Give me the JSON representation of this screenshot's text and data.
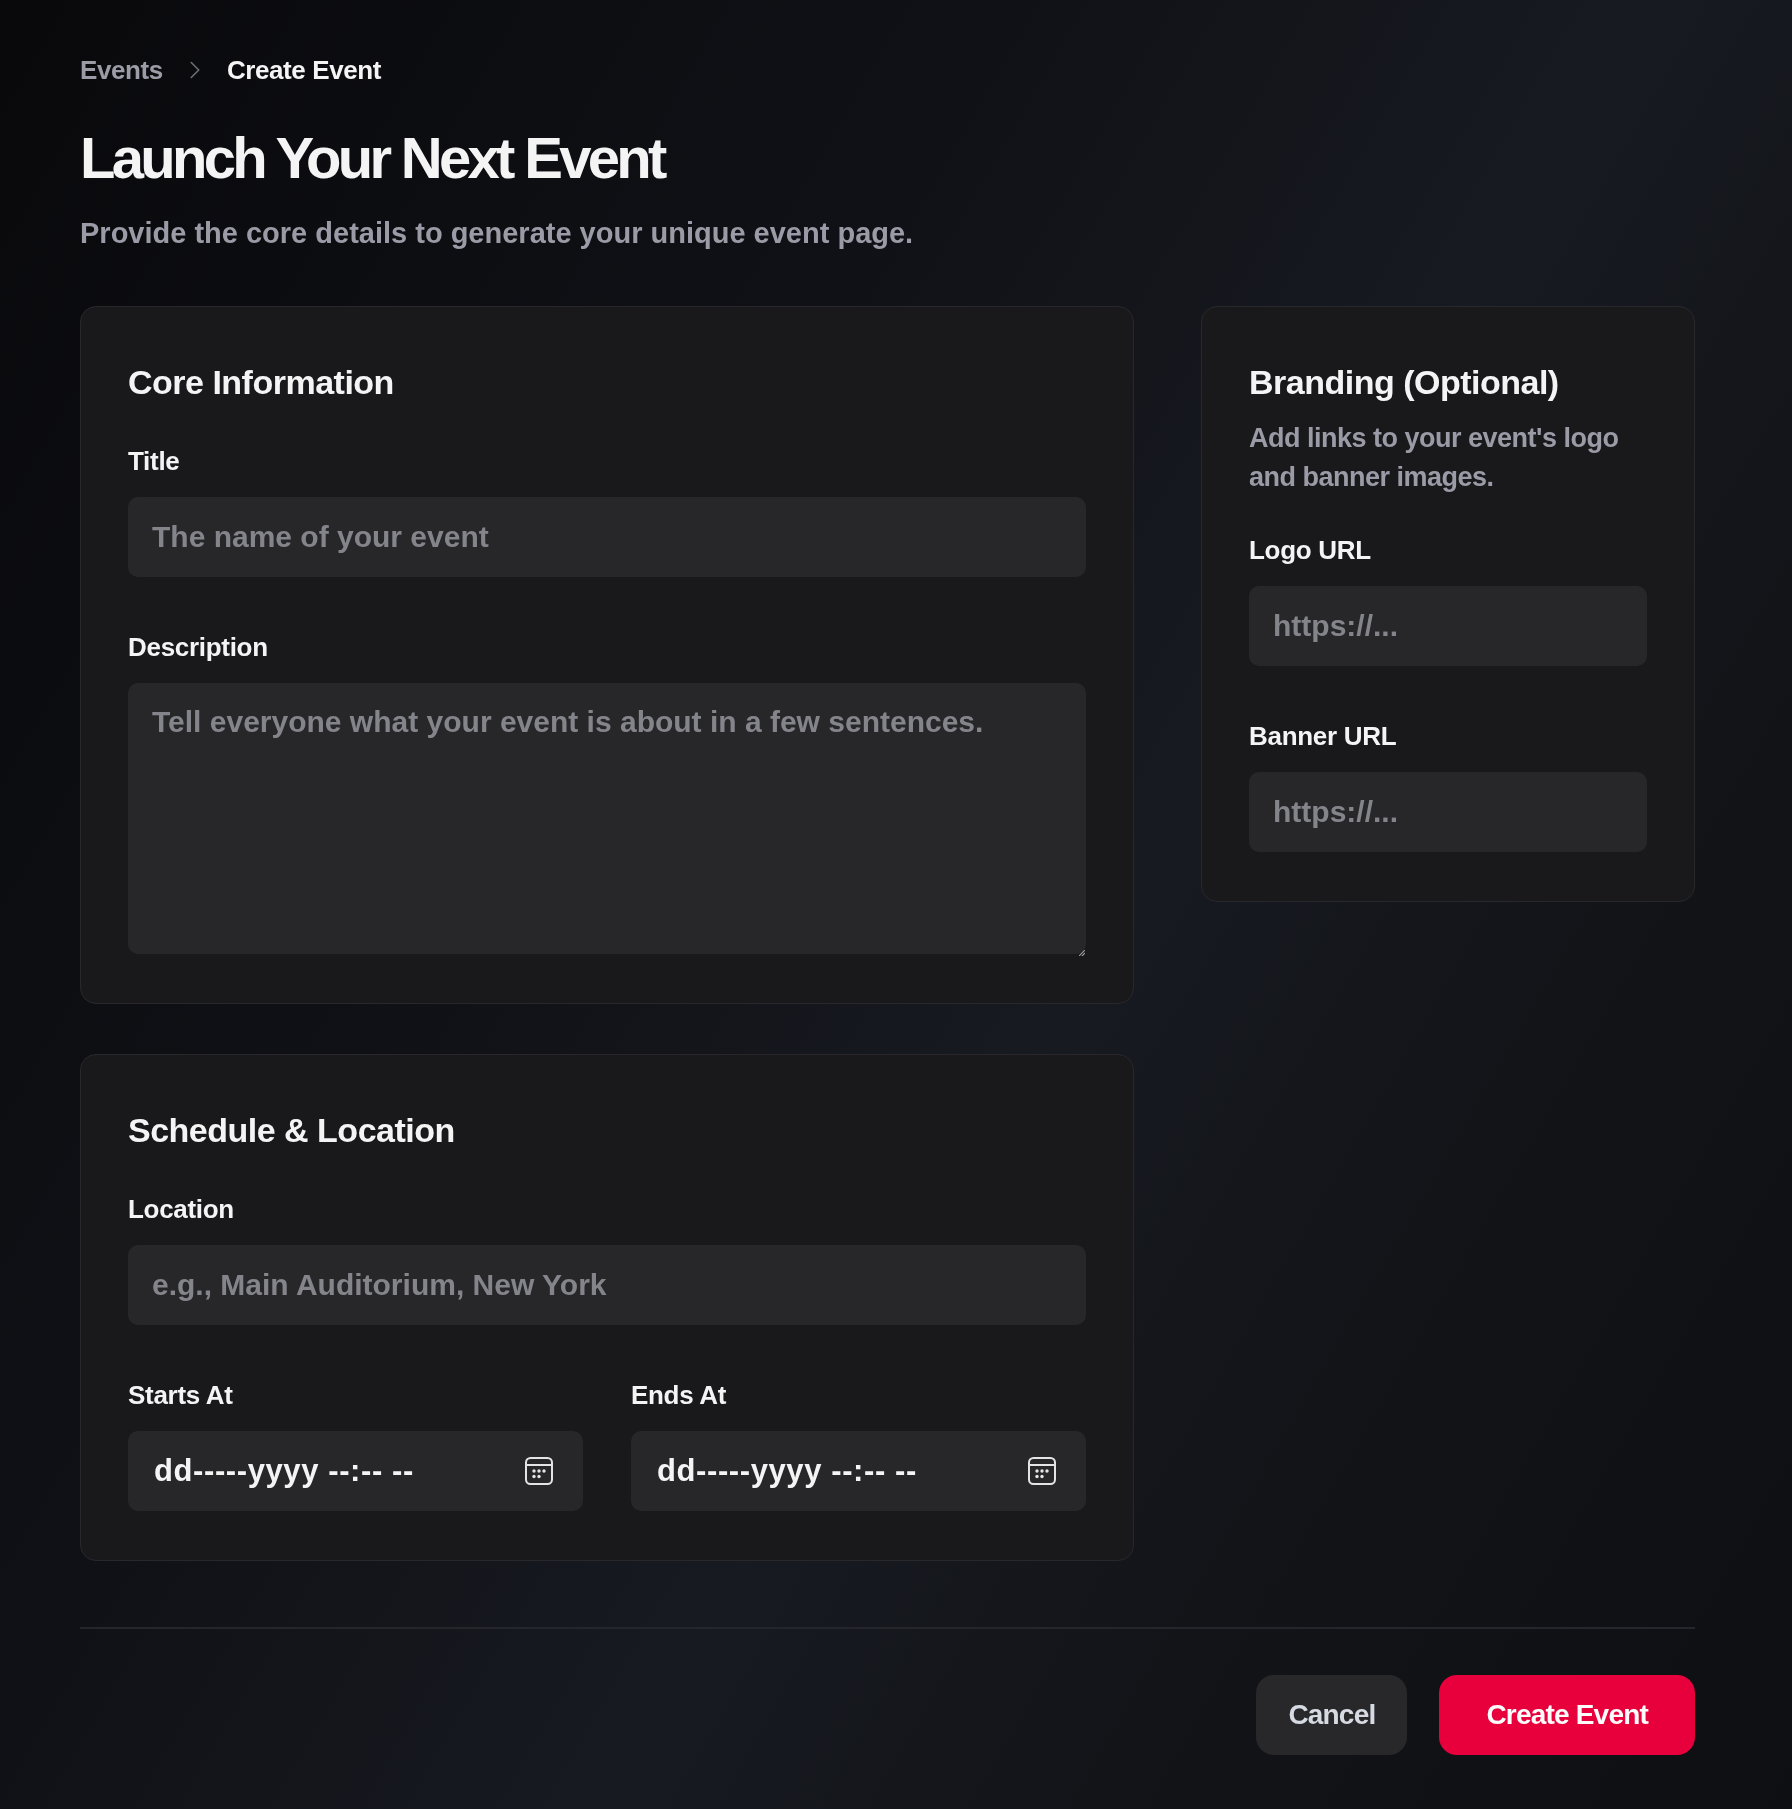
{
  "breadcrumb": [
    {
      "label": "Events",
      "current": false
    },
    {
      "label": "Create Event",
      "current": true
    }
  ],
  "page": {
    "title": "Launch Your Next Event",
    "subtitle": "Provide the core details to generate your unique event page."
  },
  "columns": [
    {
      "cards": [
        {
          "title": "Core Information",
          "fields": [
            {
              "kind": "text",
              "label": "Title",
              "placeholder": "The name of your event"
            },
            {
              "kind": "textarea",
              "label": "Description",
              "placeholder": "Tell everyone what your event is about in a few sentences."
            }
          ]
        },
        {
          "title": "Schedule & Location",
          "fields": [
            {
              "kind": "text",
              "label": "Location",
              "placeholder": "e.g., Main Auditorium, New York"
            },
            {
              "kind": "datetime",
              "label": "Starts At",
              "placeholder": "dd-----yyyy --:-- --"
            },
            {
              "kind": "datetime",
              "label": "Ends At",
              "placeholder": "dd-----yyyy --:-- --"
            }
          ]
        }
      ]
    },
    {
      "cards": [
        {
          "title": "Branding (Optional)",
          "description": "Add links to your event's logo and banner images.",
          "fields": [
            {
              "kind": "url",
              "label": "Logo URL",
              "placeholder": "https://..."
            },
            {
              "kind": "url",
              "label": "Banner URL",
              "placeholder": "https://..."
            }
          ]
        }
      ]
    }
  ],
  "actions": [
    {
      "kind": "secondary",
      "label": "Cancel"
    },
    {
      "kind": "primary",
      "label": "Create Event"
    }
  ]
}
